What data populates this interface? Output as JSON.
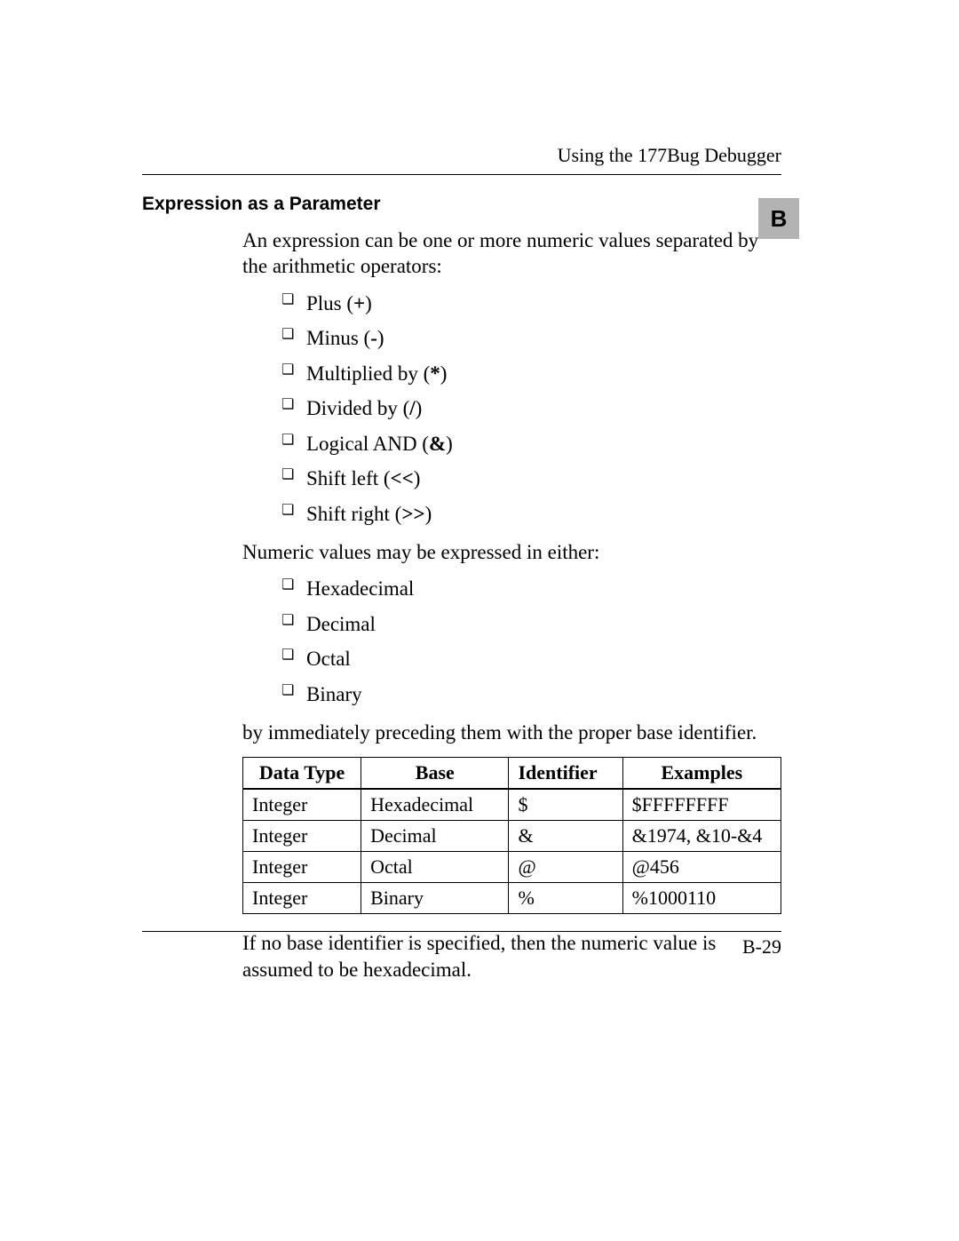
{
  "header": {
    "running_head": "Using the 177Bug Debugger",
    "section_tab": "B",
    "page_number": "B-29"
  },
  "section": {
    "heading": "Expression as a Parameter",
    "intro": "An expression can be one or more numeric values separated by the arithmetic operators:",
    "operators": [
      {
        "text": "Plus (",
        "sym": "+",
        "suffix": ")"
      },
      {
        "text": "Minus (",
        "sym": "-",
        "suffix": ")"
      },
      {
        "text": "Multiplied by (",
        "sym": "*",
        "suffix": ")"
      },
      {
        "text": "Divided by (",
        "sym": "/",
        "suffix": ")"
      },
      {
        "text": "Logical AND (",
        "sym": "&",
        "suffix": ")"
      },
      {
        "text": "Shift left (",
        "sym": "<<",
        "suffix": ")"
      },
      {
        "text": "Shift right (",
        "sym": ">>",
        "suffix": ")"
      }
    ],
    "numeric_intro": "Numeric values may be expressed in either:",
    "formats": [
      "Hexadecimal",
      "Decimal",
      "Octal",
      "Binary"
    ],
    "base_id_sentence": "by immediately preceding them with the proper base identifier.",
    "table": {
      "headers": [
        "Data Type",
        "Base",
        "Identifier",
        "Examples"
      ],
      "rows": [
        [
          "Integer",
          "Hexadecimal",
          "$",
          "$FFFFFFFF"
        ],
        [
          "Integer",
          "Decimal",
          "&",
          "&1974, &10-&4"
        ],
        [
          "Integer",
          "Octal",
          "@",
          "@456"
        ],
        [
          "Integer",
          "Binary",
          "%",
          "%1000110"
        ]
      ]
    },
    "closing": "If no base identifier is specified, then the numeric value is assumed to be hexadecimal."
  }
}
